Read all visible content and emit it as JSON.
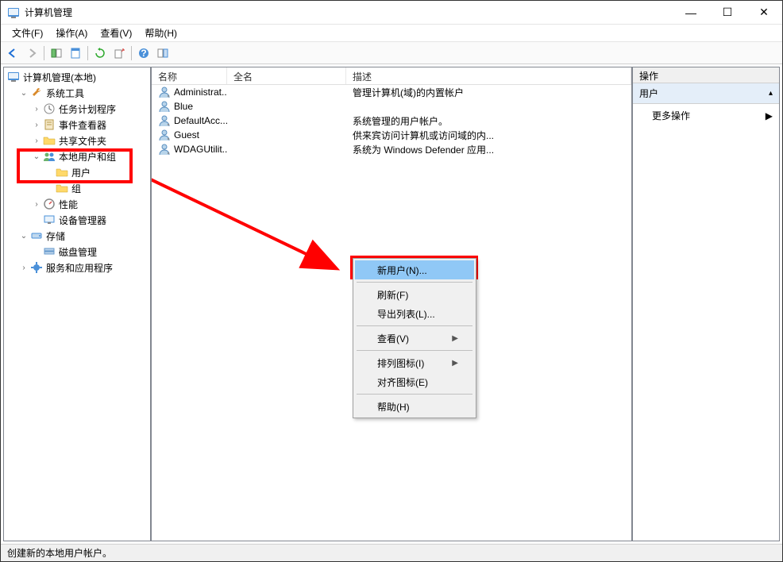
{
  "window": {
    "title": "计算机管理",
    "minimize": "—",
    "maximize": "☐",
    "close": "✕"
  },
  "menubar": {
    "file": "文件(F)",
    "action": "操作(A)",
    "view": "查看(V)",
    "help": "帮助(H)"
  },
  "tree": {
    "root": "计算机管理(本地)",
    "system_tools": "系统工具",
    "task_scheduler": "任务计划程序",
    "event_viewer": "事件查看器",
    "shared_folders": "共享文件夹",
    "local_users_groups": "本地用户和组",
    "users": "用户",
    "groups": "组",
    "performance": "性能",
    "device_manager": "设备管理器",
    "storage": "存储",
    "disk_management": "磁盘管理",
    "services_apps": "服务和应用程序"
  },
  "list": {
    "columns": {
      "name": "名称",
      "fullname": "全名",
      "description": "描述"
    },
    "rows": [
      {
        "name": "Administrat...",
        "fullname": "",
        "description": "管理计算机(域)的内置帐户"
      },
      {
        "name": "Blue",
        "fullname": "",
        "description": ""
      },
      {
        "name": "DefaultAcc...",
        "fullname": "",
        "description": "系统管理的用户帐户。"
      },
      {
        "name": "Guest",
        "fullname": "",
        "description": "供来宾访问计算机或访问域的内..."
      },
      {
        "name": "WDAGUtilit...",
        "fullname": "",
        "description": "系统为 Windows Defender 应用..."
      }
    ]
  },
  "context_menu": {
    "new_user": "新用户(N)...",
    "refresh": "刷新(F)",
    "export_list": "导出列表(L)...",
    "view": "查看(V)",
    "arrange_icons": "排列图标(I)",
    "align_icons": "对齐图标(E)",
    "help": "帮助(H)"
  },
  "actions": {
    "header": "操作",
    "section_title": "用户",
    "more_actions": "更多操作"
  },
  "statusbar": {
    "text": "创建新的本地用户帐户。"
  }
}
